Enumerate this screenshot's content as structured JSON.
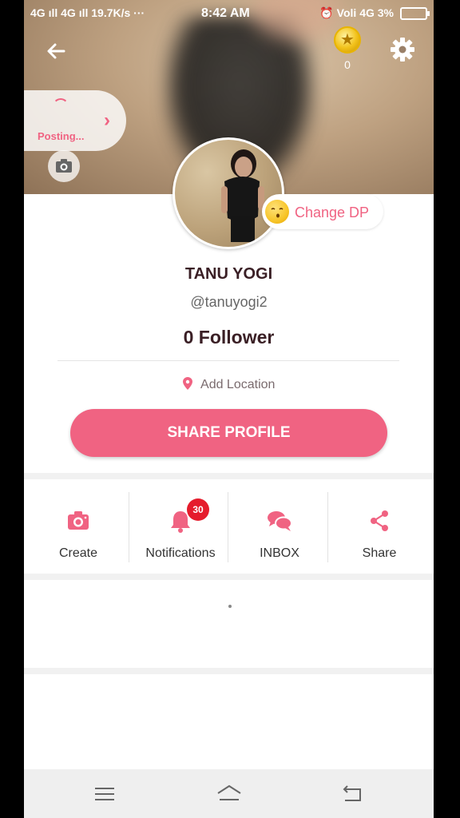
{
  "status_bar": {
    "left": "4G ıll  4G ıll  19.7K/s  ···",
    "time": "8:42 AM",
    "right": "⏰ Voli 4G 3%"
  },
  "header": {
    "coin_count": "0",
    "posting_label": "Posting...",
    "change_dp_label": "Change DP"
  },
  "profile": {
    "name": "TANU YOGI",
    "handle": "@tanuyogi2",
    "followers": "0 Follower",
    "location_label": "Add Location",
    "share_profile_label": "SHARE PROFILE"
  },
  "actions": [
    {
      "label": "Create",
      "icon": "camera-icon"
    },
    {
      "label": "Notifications",
      "icon": "bell-icon",
      "badge": "30"
    },
    {
      "label": "INBOX",
      "icon": "chat-bubbles-icon"
    },
    {
      "label": "Share",
      "icon": "share-icon"
    }
  ],
  "colors": {
    "accent": "#f06382",
    "badge": "#e51c2c",
    "text_dark": "#3a1f25"
  }
}
